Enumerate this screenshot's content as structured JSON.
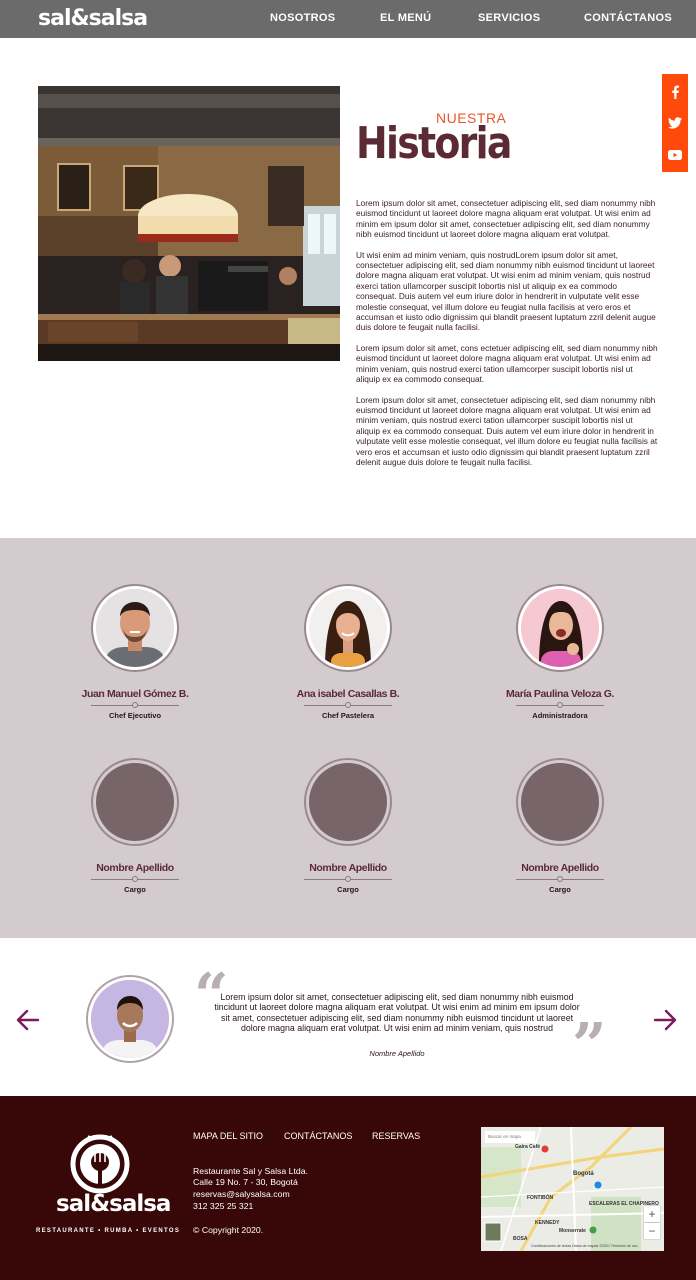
{
  "header": {
    "logo": "sal&salsa",
    "nav": [
      "NOSOTROS",
      "EL MENÚ",
      "SERVICIOS",
      "CONTÁCTANOS"
    ]
  },
  "social": [
    "facebook-icon",
    "twitter-icon",
    "youtube-icon"
  ],
  "history": {
    "eyebrow": "NUESTRA",
    "title": "Historia",
    "paragraphs": [
      "Lorem ipsum dolor sit amet, consectetuer adipiscing elit, sed diam nonummy nibh euismod tincidunt ut laoreet dolore magna aliquam erat volutpat. Ut wisi enim ad minim em ipsum dolor sit amet, consectetuer adipiscing elit, sed diam nonummy nibh euismod tincidunt ut laoreet dolore magna aliquam erat volutpat.",
      "Ut wisi enim ad minim veniam, quis nostrudLorem ipsum dolor sit amet, consectetuer adipiscing elit, sed diam nonummy nibh euismod tincidunt ut laoreet dolore magna aliquam erat volutpat. Ut wisi enim ad minim veniam, quis nostrud exerci tation ullamcorper suscipit lobortis nisl ut aliquip ex ea commodo consequat. Duis autem vel eum iriure dolor in hendrerit in vulputate velit esse molestie consequat, vel illum dolore eu feugiat nulla facilisis at vero eros et accumsan et iusto odio dignissim qui blandit praesent luptatum zzril delenit augue duis dolore te feugait nulla facilisi.",
      "Lorem ipsum dolor sit amet, cons ectetuer adipiscing elit, sed diam nonummy nibh euismod tincidunt ut laoreet dolore magna aliquam erat volutpat. Ut wisi enim ad minim veniam, quis nostrud exerci tation ullamcorper suscipit lobortis nisl ut aliquip ex ea commodo consequat.",
      "Lorem ipsum dolor sit amet, consectetuer adipiscing elit, sed diam nonummy nibh euismod tincidunt ut laoreet dolore magna aliquam erat volutpat. Ut wisi enim ad minim veniam, quis nostrud exerci tation ullamcorper suscipit lobortis nisl ut aliquip ex ea commodo consequat. Duis autem vel eum iriure dolor in hendrerit in vulputate velit esse molestie consequat, vel illum dolore eu feugiat nulla facilisis at vero eros et accumsan et iusto odio dignissim qui blandit praesent luptatum zzril delenit augue duis dolore te feugait nulla facilisi."
    ]
  },
  "team": [
    {
      "name": "Juan Manuel Gómez B.",
      "role": "Chef Ejecutivo",
      "photo": "man-photo"
    },
    {
      "name": "Ana isabel Casallas B.",
      "role": "Chef Pastelera",
      "photo": "woman-photo"
    },
    {
      "name": "María Paulina Veloza G.",
      "role": "Administradora",
      "photo": "woman-photo"
    },
    {
      "name": "Nombre Apellido",
      "role": "Cargo",
      "photo": "placeholder"
    },
    {
      "name": "Nombre Apellido",
      "role": "Cargo",
      "photo": "placeholder"
    },
    {
      "name": "Nombre Apellido",
      "role": "Cargo",
      "photo": "placeholder"
    }
  ],
  "testimonial": {
    "text": "Lorem ipsum dolor sit amet, consectetuer adipiscing elit, sed diam nonummy nibh euismod tincidunt ut laoreet dolore magna aliquam erat volutpat. Ut wisi enim ad minim em ipsum dolor sit amet, consectetuer adipiscing elit, sed diam nonummy nibh euismod tincidunt ut laoreet dolore magna aliquam erat volutpat. Ut wisi enim ad minim veniam, quis nostrud",
    "author": "Nombre Apellido"
  },
  "footer": {
    "logo": "sal&salsa",
    "tagline": "RESTAURANTE • RUMBA • EVENTOS",
    "links": [
      "MAPA DEL SITIO",
      "CONTÁCTANOS",
      "RESERVAS"
    ],
    "company": "Restaurante Sal y Salsa Ltda.",
    "address": "Calle 19 No. 7 - 30, Bogotá",
    "email": "reservas@salysalsa.com",
    "phone": "312 325 25 321",
    "copyright": "© Copyright 2020."
  },
  "map": {
    "search": "Buscar en mapa",
    "labels": [
      "Bogotá",
      "Gaira Café",
      "FONTIBÓN",
      "KENNEDY",
      "ESCALERAS EL CHAPINERO",
      "Monserrate",
      "BOSA"
    ],
    "zoom_in": "+",
    "zoom_out": "−",
    "footer": "Combinaciones de teclas   Datos de mapas ©2021   Términos de uso"
  },
  "colors": {
    "header_bg": "#6b6b6b",
    "accent_orange": "#ff4a0b",
    "title_maroon": "#5b2a34",
    "team_bg": "#d4cbcf",
    "footer_bg": "#380707",
    "arrow_purple": "#7a1a5a"
  }
}
